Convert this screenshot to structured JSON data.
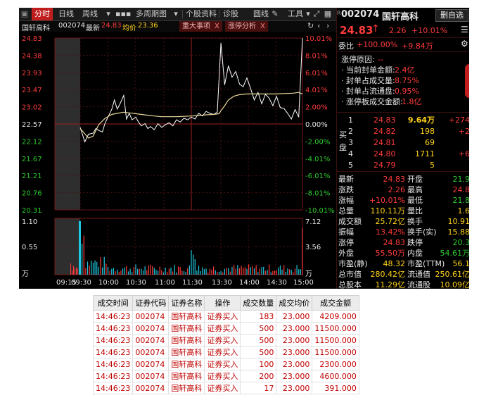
{
  "toolbar": {
    "tabs": [
      {
        "label": "分时",
        "active": true
      },
      {
        "label": "日线",
        "active": false
      },
      {
        "label": "周线",
        "active": false
      },
      {
        "label": "多周期图",
        "active": false
      },
      {
        "label": "个股资料",
        "active": false
      },
      {
        "label": "诊股",
        "active": false
      }
    ],
    "circle_label": "圆线",
    "tools_label": "工具"
  },
  "header": {
    "stock_name": "国轩高科",
    "stock_code": "002074",
    "latest_label": "最新",
    "latest_value": "24.83",
    "avg_label": "均价",
    "avg_value": "23.36",
    "panel_tabs": [
      {
        "label": "重大事项",
        "close": "X"
      },
      {
        "label": "涨停分析",
        "close": "X"
      }
    ]
  },
  "chart_data": {
    "type": "line",
    "title": "",
    "x_ticks": [
      "09:15",
      "09:30",
      "10:00",
      "10:30",
      "11:00",
      "11:30",
      "13:30",
      "14:00",
      "14:30",
      "15:00"
    ],
    "price_ticks": [
      "24.83",
      "24.38",
      "23.93",
      "23.47",
      "23.02",
      "22.57",
      "22.12",
      "21.67",
      "21.21",
      "20.76",
      "20.31"
    ],
    "pct_ticks": [
      "10.01%",
      "8.01%",
      "6.01%",
      "4.01%",
      "2.00%",
      "0.00%",
      "-2.00%",
      "-4.01%",
      "-6.01%",
      "-8.01%",
      "-10.01%"
    ],
    "ylim": [
      20.31,
      24.83
    ],
    "prev_close": 22.57,
    "vol_left_ticks": [
      "1.10",
      "0.55",
      "万"
    ],
    "vol_right_ticks": [
      "7.12",
      "3.56",
      "万"
    ],
    "series": [
      {
        "color": "#ffffff",
        "x": [
          0,
          5,
          9,
          14,
          17,
          20,
          24,
          27,
          30,
          34,
          37,
          40,
          43,
          47,
          50,
          53,
          56,
          60,
          63,
          66,
          70,
          73,
          76,
          80,
          84,
          88,
          92,
          96,
          100,
          104,
          108,
          112,
          116,
          120,
          124,
          128,
          132,
          136,
          140,
          144,
          148,
          152,
          156,
          160,
          164,
          168,
          172,
          176,
          180,
          184,
          188,
          192,
          196,
          200,
          204,
          208,
          212,
          216,
          220,
          224,
          228,
          232,
          236,
          240
        ],
        "values": [
          22.48,
          22.1,
          22.3,
          22.33,
          22.45,
          22.4,
          22.36,
          22.6,
          22.75,
          22.95,
          23.2,
          22.96,
          23.1,
          23.32,
          22.7,
          22.85,
          22.68,
          22.75,
          22.62,
          22.52,
          22.58,
          22.45,
          22.5,
          22.42,
          22.58,
          22.48,
          22.55,
          22.6,
          22.52,
          22.68,
          22.62,
          22.72,
          22.68,
          22.75,
          22.7,
          22.85,
          22.78,
          22.9,
          22.85,
          22.82,
          22.88,
          24.7,
          23.6,
          24.1,
          23.8,
          23.95,
          23.62,
          23.55,
          23.78,
          23.5,
          23.2,
          23.4,
          23.1,
          23.35,
          23.25,
          23.05,
          23.3,
          23.0,
          22.98,
          22.85,
          22.7,
          22.95,
          22.75,
          24.83
        ]
      },
      {
        "color": "#e8d79a",
        "x": [
          0,
          9,
          14,
          20,
          27,
          34,
          40,
          47,
          53,
          60,
          66,
          73,
          80,
          88,
          96,
          104,
          112,
          120,
          128,
          136,
          144,
          150,
          152,
          156,
          160,
          166,
          172,
          180,
          190,
          200,
          210,
          220,
          230,
          236,
          240
        ],
        "values": [
          22.45,
          22.2,
          22.25,
          22.55,
          22.72,
          22.82,
          22.85,
          22.88,
          22.86,
          22.84,
          22.82,
          22.8,
          22.78,
          22.76,
          22.76,
          22.76,
          22.77,
          22.78,
          22.79,
          22.81,
          22.82,
          22.84,
          22.92,
          23.05,
          23.2,
          23.3,
          23.34,
          23.36,
          23.36,
          23.36,
          23.36,
          23.37,
          23.38,
          23.4,
          23.36
        ]
      }
    ]
  },
  "quote": {
    "code": "002074",
    "name": "国轩高科",
    "add_button": "删自选",
    "price": "24.83",
    "change": "2.26",
    "change_pct": "+10.01%",
    "ratio_label": "委比",
    "ratio_value": "+100.00%",
    "ratio_diff": "+9.84万",
    "limit_info": [
      {
        "label": "涨停原因:",
        "value": "--"
      },
      {
        "label": "· 当前封单金额:",
        "value": "2.4亿"
      },
      {
        "label": "· 封单占成交量:",
        "value": "8.75%"
      },
      {
        "label": "· 封单占流通盘:",
        "value": "0.95%"
      },
      {
        "label": "· 涨停板成交金额:",
        "value": "1.8亿"
      }
    ],
    "buy_label_1": "买",
    "buy_label_2": "盘",
    "buys": [
      {
        "level": "1",
        "price": "24.83",
        "vol": "9.64万",
        "delta": "+274"
      },
      {
        "level": "2",
        "price": "24.82",
        "vol": "198",
        "delta": "+2"
      },
      {
        "level": "3",
        "price": "24.81",
        "vol": "69",
        "delta": ""
      },
      {
        "level": "4",
        "price": "24.80",
        "vol": "1711",
        "delta": "+6"
      },
      {
        "level": "5",
        "price": "24.79",
        "vol": "5",
        "delta": ""
      }
    ],
    "stats": [
      {
        "l1": "最新",
        "v1": "24.83",
        "l2": "开盘",
        "v2": "21.9"
      },
      {
        "l1": "涨跌",
        "v1": "2.26",
        "l2": "最高",
        "v2": "24.8"
      },
      {
        "l1": "涨幅",
        "v1": "+10.01%",
        "l2": "最低",
        "v2": "21.8"
      },
      {
        "l1": "总量",
        "v1": "110.11万",
        "l2": "量比",
        "v2": "1.6"
      },
      {
        "l1": "成交额",
        "v1": "25.72亿",
        "l2": "换手",
        "v2": "10.91"
      },
      {
        "l1": "振幅",
        "v1": "13.42%",
        "l2": "换手(实)",
        "v2": "15.88"
      },
      {
        "l1": "涨停",
        "v1": "24.83",
        "l2": "跌停",
        "v2": "20.3"
      },
      {
        "l1": "外盘",
        "v1": "55.50万",
        "l2": "内盘",
        "v2": "54.61万"
      },
      {
        "l1": "市盈(静)",
        "v1": "48.32",
        "l2": "市盈(TTM)",
        "v2": "56.1"
      },
      {
        "l1": "总市值",
        "v1": "280.42亿",
        "l2": "流通值",
        "v2": "250.61亿"
      },
      {
        "l1": "总股本",
        "v1": "11.29亿",
        "l2": "流通股",
        "v2": "10.09亿"
      }
    ]
  },
  "trades": {
    "headers": [
      "成交时间",
      "证券代码",
      "证券名称",
      "操作",
      "成交数量",
      "成交均价",
      "成交金额"
    ],
    "rows": [
      [
        "14:46:23",
        "002074",
        "国轩高科",
        "证券买入",
        "183",
        "23.000",
        "4209.000"
      ],
      [
        "14:46:23",
        "002074",
        "国轩高科",
        "证券买入",
        "500",
        "23.000",
        "11500.000"
      ],
      [
        "14:46:23",
        "002074",
        "国轩高科",
        "证券买入",
        "500",
        "23.000",
        "11500.000"
      ],
      [
        "14:46:23",
        "002074",
        "国轩高科",
        "证券买入",
        "500",
        "23.000",
        "11500.000"
      ],
      [
        "14:46:23",
        "002074",
        "国轩高科",
        "证券买入",
        "100",
        "23.000",
        "2300.000"
      ],
      [
        "14:46:23",
        "002074",
        "国轩高科",
        "证券买入",
        "200",
        "23.000",
        "4600.000"
      ],
      [
        "14:46:23",
        "002074",
        "国轩高科",
        "证券买入",
        "17",
        "23.000",
        "391.000"
      ]
    ]
  }
}
